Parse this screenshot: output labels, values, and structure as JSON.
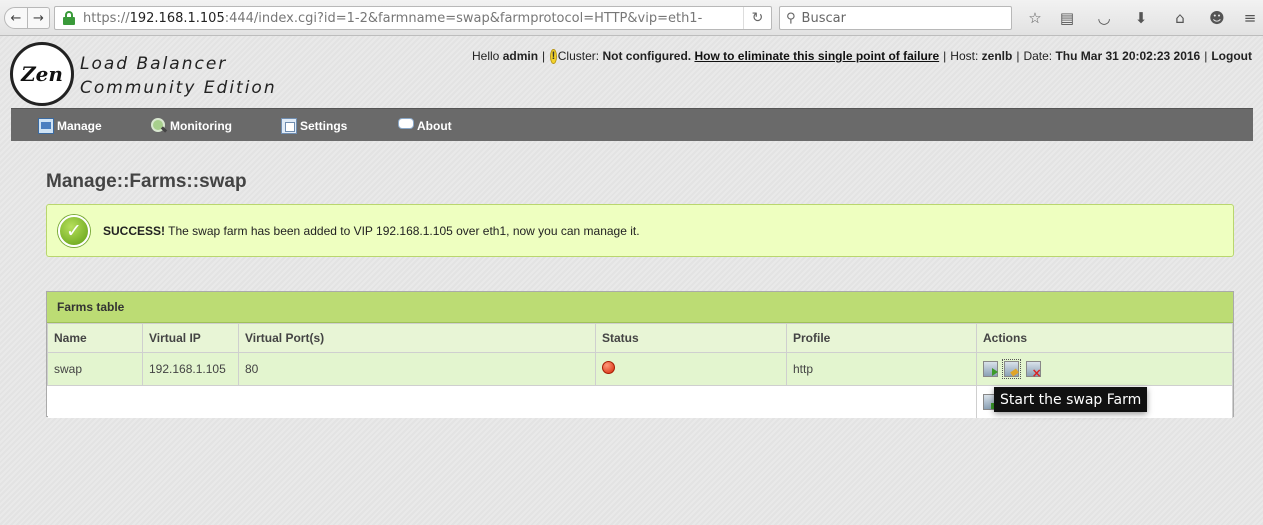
{
  "browser": {
    "url_prefix": "https://",
    "url_host": "192.168.1.105",
    "url_rest": ":444/index.cgi?id=1-2&farmname=swap&farmprotocol=HTTP&vip=eth1-",
    "search_placeholder": "Buscar"
  },
  "logo": {
    "mark": "Zen",
    "line1": "Load Balancer",
    "line2": "Community  Edition"
  },
  "header": {
    "hello": "Hello",
    "user": "admin",
    "cluster_label": "Cluster:",
    "cluster_value": "Not configured.",
    "cluster_link": "How to eliminate this single point of failure",
    "host_label": "Host:",
    "host_value": "zenlb",
    "date_label": "Date:",
    "date_value": "Thu Mar 31 20:02:23 2016",
    "logout": "Logout"
  },
  "menu": {
    "manage": "Manage",
    "monitoring": "Monitoring",
    "settings": "Settings",
    "about": "About"
  },
  "page": {
    "title": "Manage::Farms::swap"
  },
  "alert": {
    "strong": "SUCCESS!",
    "message": "The swap farm has been added to VIP 192.168.1.105 over eth1, now you can manage it."
  },
  "farms": {
    "title": "Farms table",
    "columns": [
      "Name",
      "Virtual IP",
      "Virtual Port(s)",
      "Status",
      "Profile",
      "Actions"
    ],
    "rows": [
      {
        "name": "swap",
        "vip": "192.168.1.105",
        "port": "80",
        "status": "stopped",
        "profile": "http"
      }
    ]
  },
  "tooltip": "Start the swap Farm",
  "colors": {
    "menubar": "#6a6a6a",
    "success_bg": "#eeffc0",
    "table_header": "#bcdc74",
    "status_stopped": "#d5280a"
  }
}
